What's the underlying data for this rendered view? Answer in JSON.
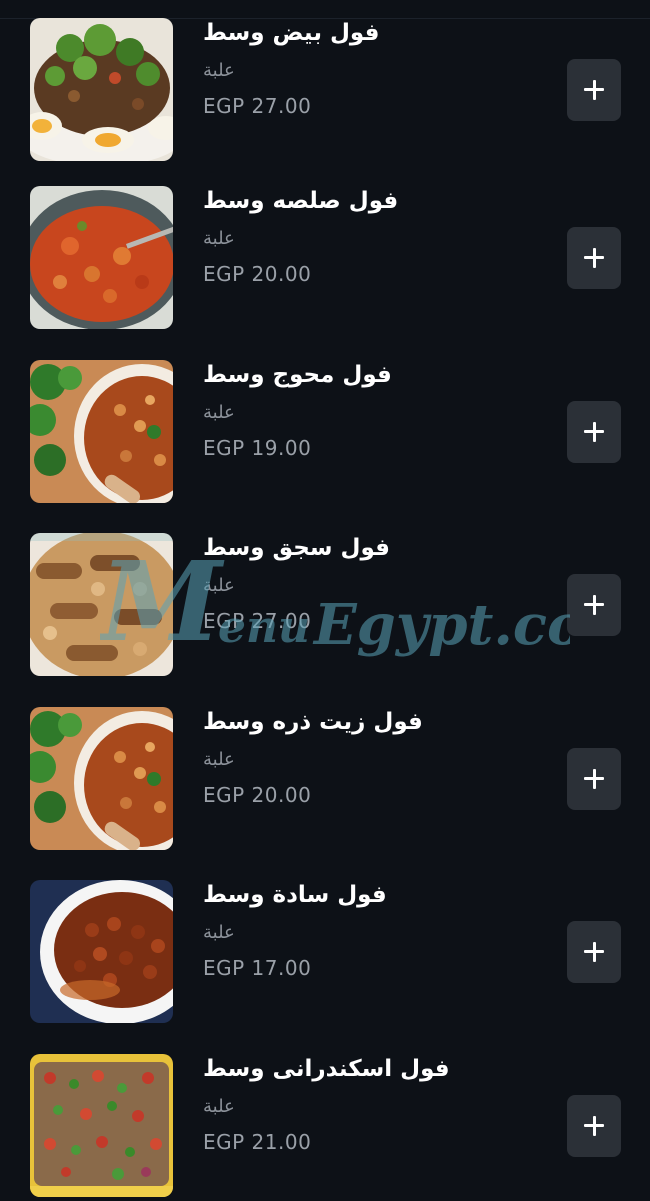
{
  "items": [
    {
      "title": "فول بيض وسط",
      "unit": "علبة",
      "price": "EGP 27.00",
      "image": "beans-with-egg-photo"
    },
    {
      "title": "فول صلصه وسط",
      "unit": "علبة",
      "price": "EGP 20.00",
      "image": "beans-tomato-sauce-photo"
    },
    {
      "title": "فول محوج وسط",
      "unit": "علبة",
      "price": "EGP 19.00",
      "image": "spiced-beans-bowl-photo"
    },
    {
      "title": "فول سجق وسط",
      "unit": "علبة",
      "price": "EGP 27.00",
      "image": "beans-sausage-photo"
    },
    {
      "title": "فول زيت ذره وسط",
      "unit": "علبة",
      "price": "EGP 20.00",
      "image": "beans-corn-oil-bowl-photo"
    },
    {
      "title": "فول سادة وسط",
      "unit": "علبة",
      "price": "EGP 17.00",
      "image": "plain-beans-bowl-photo"
    },
    {
      "title": "فول اسكندرانى وسط",
      "unit": "علبة",
      "price": "EGP 21.00",
      "image": "alexandrian-beans-photo"
    }
  ],
  "add_button": {
    "icon": "plus-icon"
  },
  "watermark": {
    "text": "MenuEgypt.com"
  },
  "colors": {
    "background": "#0d1117",
    "button": "#2b3037",
    "title": "#ffffff",
    "muted": "#8b9199",
    "watermark": "#5aa3b8"
  }
}
